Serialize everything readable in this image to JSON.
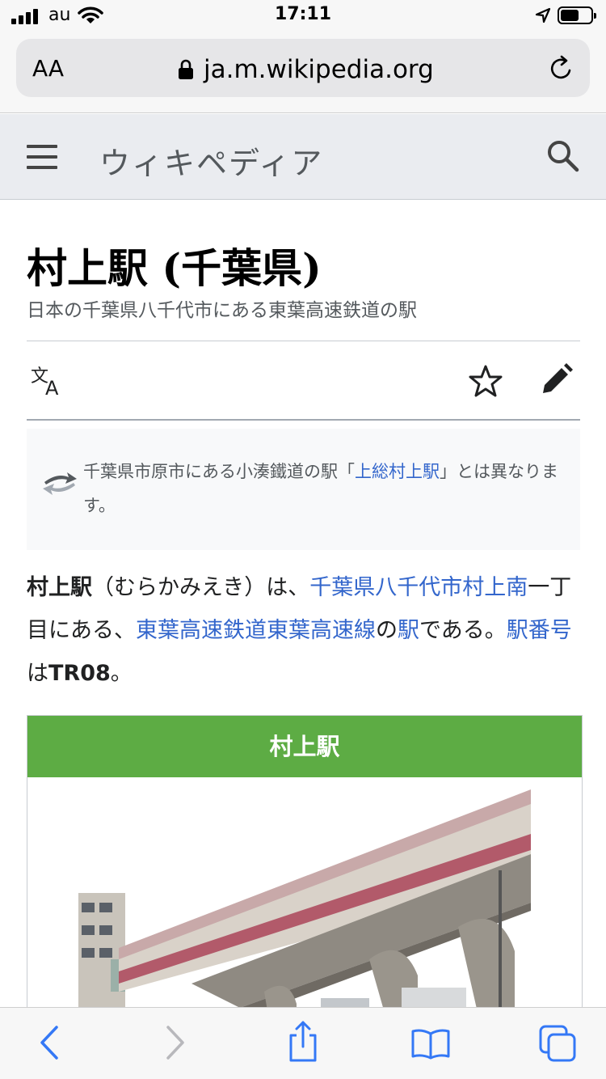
{
  "status_bar": {
    "carrier": "au",
    "time": "17:11",
    "battery_level": 0.6
  },
  "browser": {
    "text_size_label": "AA",
    "url": "ja.m.wikipedia.org"
  },
  "wiki_header": {
    "wordmark": "ウィキペディア"
  },
  "article": {
    "title": "村上駅 (千葉県)",
    "description": "日本の千葉県八千代市にある東葉高速鉄道の駅",
    "hatnote": {
      "before": "千葉県市原市にある小湊鐵道の駅「",
      "link": "上総村上駅",
      "after": "」とは異なります。"
    },
    "paragraph": {
      "bold_term": "村上駅",
      "reading": "（むらかみえき）は、",
      "link_location": "千葉県八千代市村上南",
      "text_1": "一丁目にある、",
      "link_line": "東葉高速鉄道東葉高速線",
      "text_2": "の",
      "link_station": "駅",
      "text_3": "である。",
      "link_number": "駅番号",
      "text_4": "は",
      "bold_code": "TR08",
      "text_5": "。"
    },
    "infobox": {
      "header": "村上駅",
      "header_color": "#5dac44"
    }
  },
  "colors": {
    "link": "#3366cc",
    "header_bg": "#eaecf0",
    "toolbar_icon": "#3478f6"
  },
  "icons": [
    "signal-icon",
    "wifi-icon",
    "location-arrow-icon",
    "battery-icon",
    "lock-icon",
    "reload-icon",
    "menu-icon",
    "search-icon",
    "language-icon",
    "star-icon",
    "edit-pencil-icon",
    "swap-arrows-icon",
    "back-icon",
    "forward-icon",
    "share-icon",
    "bookmarks-icon",
    "tabs-icon"
  ]
}
